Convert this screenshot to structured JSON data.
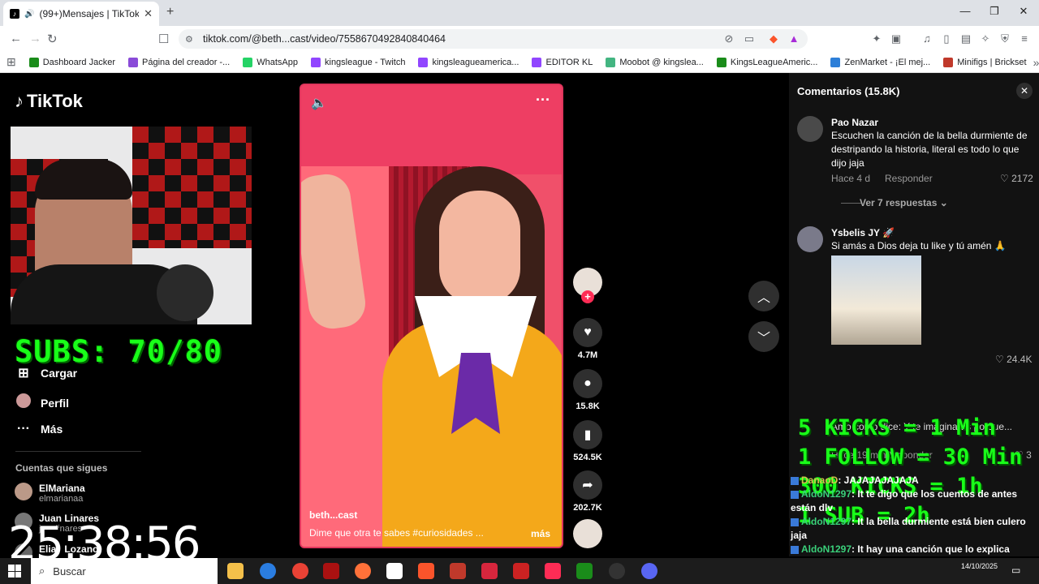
{
  "browser": {
    "tab_title": "(99+)Mensajes | TikTok",
    "url": "tiktok.com/@beth...cast/video/7558670492840840464",
    "bookmarks": [
      {
        "label": "Dashboard Jacker",
        "color": "#1a8c1a"
      },
      {
        "label": "Página del creador -...",
        "color": "#8a4bd8"
      },
      {
        "label": "WhatsApp",
        "color": "#25d366"
      },
      {
        "label": "kingsleague - Twitch",
        "color": "#9146ff"
      },
      {
        "label": "kingsleagueamerica...",
        "color": "#9146ff"
      },
      {
        "label": "EDITOR KL",
        "color": "#9146ff"
      },
      {
        "label": "Moobot @ kingslea...",
        "color": "#43b581"
      },
      {
        "label": "KingsLeagueAmeric...",
        "color": "#1a8c1a"
      },
      {
        "label": "ZenMarket - ¡El mej...",
        "color": "#2d7fd8"
      },
      {
        "label": "Minifigs | Brickset",
        "color": "#c0392b"
      }
    ]
  },
  "sidebar": {
    "logo": "TikTok",
    "nav": [
      {
        "label": "Cargar",
        "icon": "plus-square-icon"
      },
      {
        "label": "Perfil",
        "icon": "avatar-icon"
      },
      {
        "label": "Más",
        "icon": "more-icon"
      }
    ],
    "follows_title": "Cuentas que sigues",
    "follows": [
      {
        "name": "ElMariana",
        "user": "elmarianaa"
      },
      {
        "name": "Juan Linares",
        "user": "juanlinaresr"
      },
      {
        "name": "Elias Lozano",
        "user": ""
      }
    ]
  },
  "overlay": {
    "subs": "SUBS: 70/80",
    "timer": "25:38:56",
    "kicks": [
      "5 KICKS = 1 Min",
      "1 FOLLOW = 30 Min",
      "300 KICKS = 1h",
      "1 SUB = 2h"
    ]
  },
  "video": {
    "author": "beth...cast",
    "description": "Dime que otra te sabes  #curiosidades  ...",
    "more": "más",
    "likes": "4.7M",
    "comments": "15.8K",
    "saves": "524.5K",
    "shares": "202.7K"
  },
  "comments": {
    "header": "Comentarios (15.8K)",
    "items": [
      {
        "name": "Pao Nazar",
        "text": "Escuchen la canción de la bella durmiente de destripando la historia, literal es todo lo que dijo jaja",
        "time": "Hace 4 d",
        "reply": "Responder",
        "likes": "2172",
        "replies": "Ver 7 respuestas"
      },
      {
        "name": "Ysbelis JY 🚀",
        "text": "Si amás a Dios deja tu like y tú amén 🙏",
        "likes": "24.4K"
      },
      {
        "name": "",
        "text": "Amo como dice: Y te imaginaras porque...",
        "time": "Hace 19 min",
        "reply": "Responder",
        "likes": "3"
      }
    ]
  },
  "chat": [
    {
      "user": "DanaoD",
      "msg": ": JAJAJAJAJAJA",
      "color": "#d4c24c"
    },
    {
      "user": "AldoN1297",
      "msg": ": It te digo que los cuentos de antes están dlv",
      "color": "#3ad07a"
    },
    {
      "user": "AldoN1297",
      "msg": ": It la bella durmiente está bien culero jaja",
      "color": "#3ad07a"
    },
    {
      "user": "AldoN1297",
      "msg": ": It hay una canción que lo explica jajajaja",
      "color": "#3ad07a"
    }
  ],
  "taskbar": {
    "search": "Buscar",
    "date": "14/10/2025"
  }
}
